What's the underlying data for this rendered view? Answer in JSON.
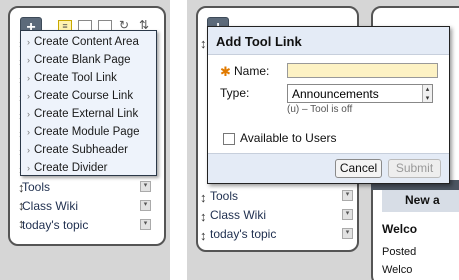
{
  "left": {
    "menu": {
      "items": [
        "Create Content Area",
        "Create Blank Page",
        "Create Tool Link",
        "Create Course Link",
        "Create External Link",
        "Create Module Page",
        "Create Subheader",
        "Create Divider"
      ]
    },
    "nav_items": [
      "Tools",
      "Class Wiki",
      "today's topic"
    ]
  },
  "right": {
    "dialog": {
      "title": "Add Tool Link",
      "name_label": "Name:",
      "type_label": "Type:",
      "type_value": "Announcements",
      "tool_off_note": "(u) – Tool is off",
      "available_label": "Available to Users",
      "cancel_label": "Cancel",
      "submit_label": "Submit"
    },
    "nav_items": [
      "Tools",
      "Class Wiki",
      "today's topic"
    ],
    "content": {
      "new_label": "New a",
      "welcome_label": "Welco",
      "posted_label": "Posted",
      "welcome2_label": "Welco"
    }
  }
}
